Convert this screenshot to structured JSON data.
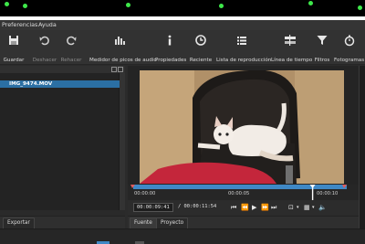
{
  "menu": {
    "items": [
      "Preferencias",
      "Ayuda"
    ]
  },
  "toolbar": {
    "buttons": [
      {
        "label": "Guardar",
        "icon": "save-icon",
        "enabled": true
      },
      {
        "label": "Deshacer",
        "icon": "undo-icon",
        "enabled": false
      },
      {
        "label": "Rehacer",
        "icon": "redo-icon",
        "enabled": false
      },
      {
        "label": "Medidor de picos de audio",
        "icon": "audio-meter-icon",
        "enabled": true
      },
      {
        "label": "Propiedades",
        "icon": "info-icon",
        "enabled": true
      },
      {
        "label": "Reciente",
        "icon": "clock-icon",
        "enabled": true
      },
      {
        "label": "Lista de reproducción",
        "icon": "list-icon",
        "enabled": true
      },
      {
        "label": "Línea de tiempo",
        "icon": "timeline-icon",
        "enabled": true
      },
      {
        "label": "Filtros",
        "icon": "filter-icon",
        "enabled": true
      },
      {
        "label": "Fotogramas c",
        "icon": "stopwatch-icon",
        "enabled": true
      }
    ]
  },
  "playlist": {
    "items": [
      "IMG_9474.MOV"
    ],
    "selected_index": 0
  },
  "left_tabs": {
    "export_label": "Exportar"
  },
  "viewer": {
    "ruler_ticks": [
      "00:00:00",
      "00:00:05",
      "00:00:10"
    ],
    "current_time": "00:00:09:41",
    "total_time": "/ 00:00:11:54",
    "source_tab": "Fuente",
    "project_tab": "Proyecto",
    "playhead_fraction": 0.84
  },
  "colors": {
    "accent": "#3f88c5",
    "selection": "#2b6fa3",
    "in_out_marker": "#e05a5a"
  }
}
